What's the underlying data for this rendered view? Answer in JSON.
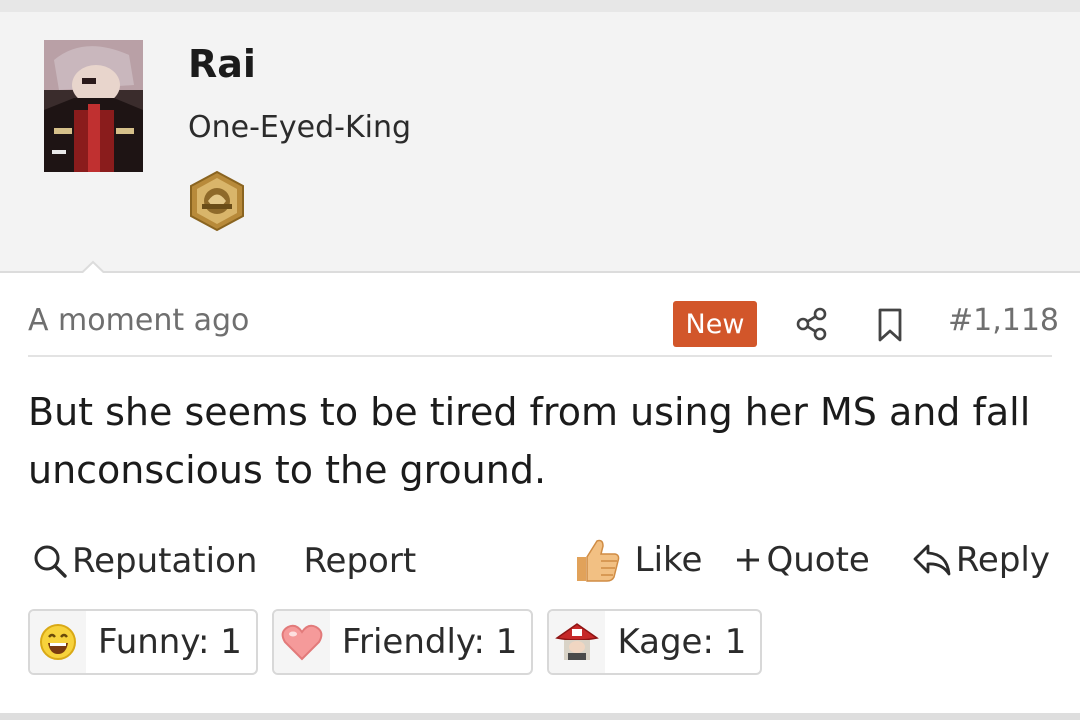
{
  "author": {
    "name": "Rai",
    "user_title": "One-Eyed-King"
  },
  "post": {
    "time": "A moment ago",
    "new_badge": "New",
    "number": "#1,118",
    "message": "But she seems to be tired from using her MS and fall unconscious to the ground."
  },
  "actions": {
    "reputation": "Reputation",
    "report": "Report",
    "like": "Like",
    "quote": "Quote",
    "reply": "Reply"
  },
  "reactions": [
    {
      "label": "Funny: 1",
      "icon": "funny-face-icon"
    },
    {
      "label": "Friendly: 1",
      "icon": "heart-icon"
    },
    {
      "label": "Kage: 1",
      "icon": "kage-hat-icon"
    }
  ],
  "colors": {
    "accent": "#d2562a",
    "header_bg": "#f3f3f3",
    "post_bg": "#ffffff",
    "muted_text": "#6f6f6f"
  }
}
